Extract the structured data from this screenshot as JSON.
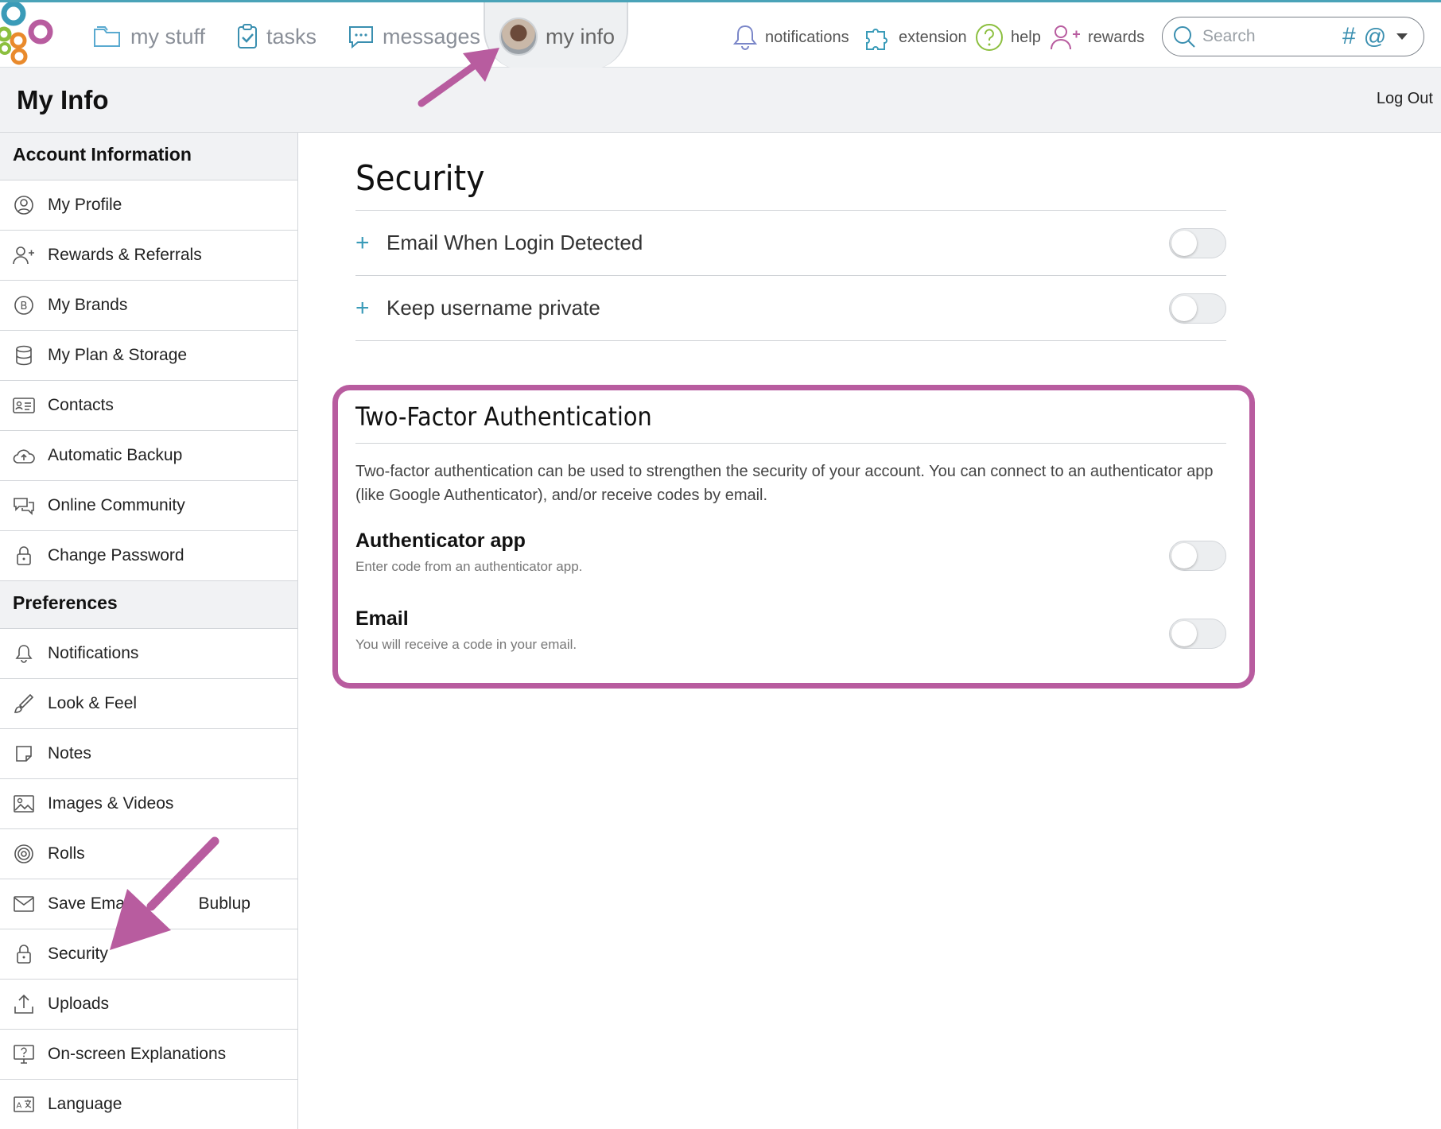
{
  "nav": {
    "my_stuff": "my stuff",
    "tasks": "tasks",
    "messages": "messages",
    "my_info": "my info",
    "notifications": "notifications",
    "extension": "extension",
    "help": "help",
    "rewards": "rewards",
    "search_placeholder": "Search",
    "hash_symbol": "#",
    "at_symbol": "@"
  },
  "header": {
    "title": "My Info",
    "logout": "Log Out"
  },
  "sidebar": {
    "account_header": "Account Information",
    "account_items": [
      {
        "label": "My Profile",
        "icon": "profile-icon"
      },
      {
        "label": "Rewards & Referrals",
        "icon": "add-user-icon"
      },
      {
        "label": "My Brands",
        "icon": "brand-icon"
      },
      {
        "label": "My Plan & Storage",
        "icon": "database-icon"
      },
      {
        "label": "Contacts",
        "icon": "contact-card-icon"
      },
      {
        "label": "Automatic Backup",
        "icon": "cloud-upload-icon"
      },
      {
        "label": "Online Community",
        "icon": "chat-icon"
      },
      {
        "label": "Change Password",
        "icon": "lock-icon"
      }
    ],
    "pref_header": "Preferences",
    "pref_items": [
      {
        "label": "Notifications",
        "icon": "bell-icon"
      },
      {
        "label": "Look & Feel",
        "icon": "brush-icon"
      },
      {
        "label": "Notes",
        "icon": "note-icon"
      },
      {
        "label": "Images & Videos",
        "icon": "image-icon"
      },
      {
        "label": "Rolls",
        "icon": "spiral-icon"
      },
      {
        "label": "Save Emai",
        "label_tail": "Bublup",
        "icon": "envelope-icon"
      },
      {
        "label": "Security",
        "icon": "lock-icon"
      },
      {
        "label": "Uploads",
        "icon": "upload-icon"
      },
      {
        "label": "On-screen Explanations",
        "icon": "help-screen-icon"
      },
      {
        "label": "Language",
        "icon": "language-icon"
      }
    ]
  },
  "main": {
    "title": "Security",
    "settings": [
      {
        "label": "Email When Login Detected",
        "enabled": false
      },
      {
        "label": "Keep username private",
        "enabled": false
      }
    ],
    "tfa": {
      "title": "Two-Factor Authentication",
      "description": "Two-factor authentication can be used to strengthen the security of your account. You can connect to an authenticator app (like Google Authenticator), and/or receive codes by email.",
      "options": [
        {
          "title": "Authenticator app",
          "subtitle": "Enter code from an authenticator app.",
          "enabled": false
        },
        {
          "title": "Email",
          "subtitle": "You will receive a code in your email.",
          "enabled": false
        }
      ]
    }
  },
  "colors": {
    "accent": "#b85c9f",
    "teal": "#3a9bb8"
  }
}
